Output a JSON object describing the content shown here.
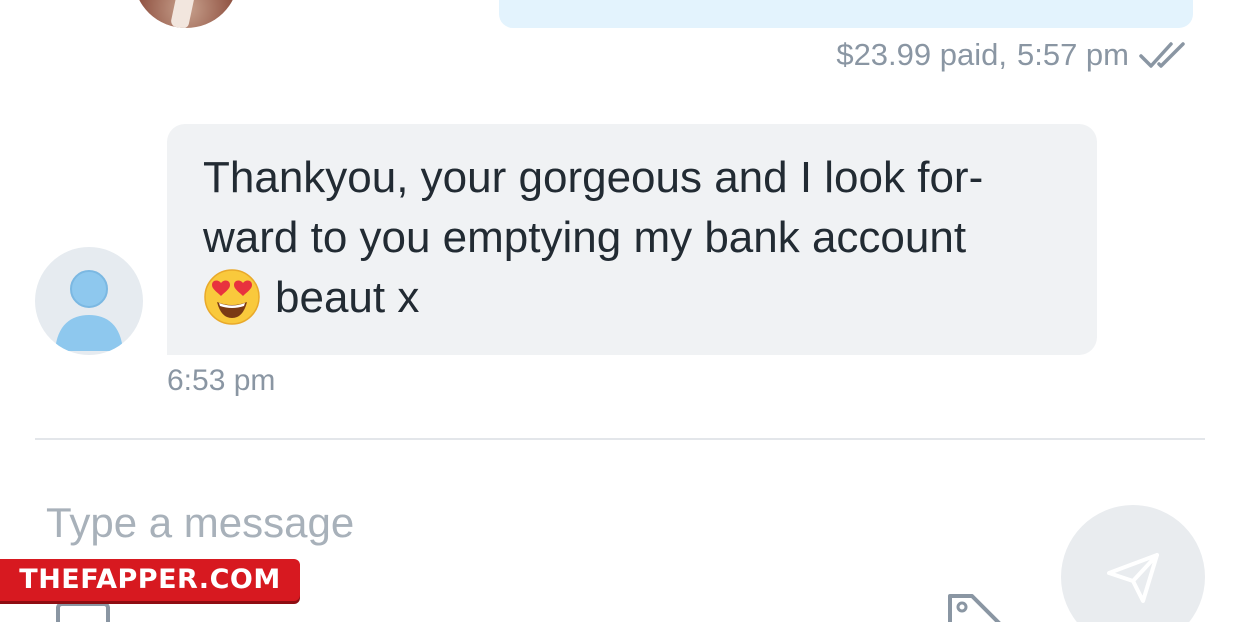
{
  "outgoing_message": {
    "paid_label": "$23.99 paid,",
    "time": "5:57 pm",
    "status_icon": "double-check-icon"
  },
  "incoming_message": {
    "lines": [
      "Thankyou, your gorgeous and I look for-",
      "ward to you emptying my bank account",
      "beaut x"
    ],
    "emoji": "heart-eyes-emoji",
    "time": "6:53 pm"
  },
  "composer": {
    "placeholder": "Type a message",
    "value": "",
    "send_icon": "send-icon",
    "media_icon": "image-icon",
    "price_icon": "price-tag-icon"
  },
  "watermark": {
    "text": "THEFAPPER.COM"
  },
  "colors": {
    "outgoing_bubble": "#e3f3fd",
    "incoming_bubble": "#f0f2f4",
    "meta_text": "#8a96a3",
    "watermark_bg": "#d71920"
  }
}
